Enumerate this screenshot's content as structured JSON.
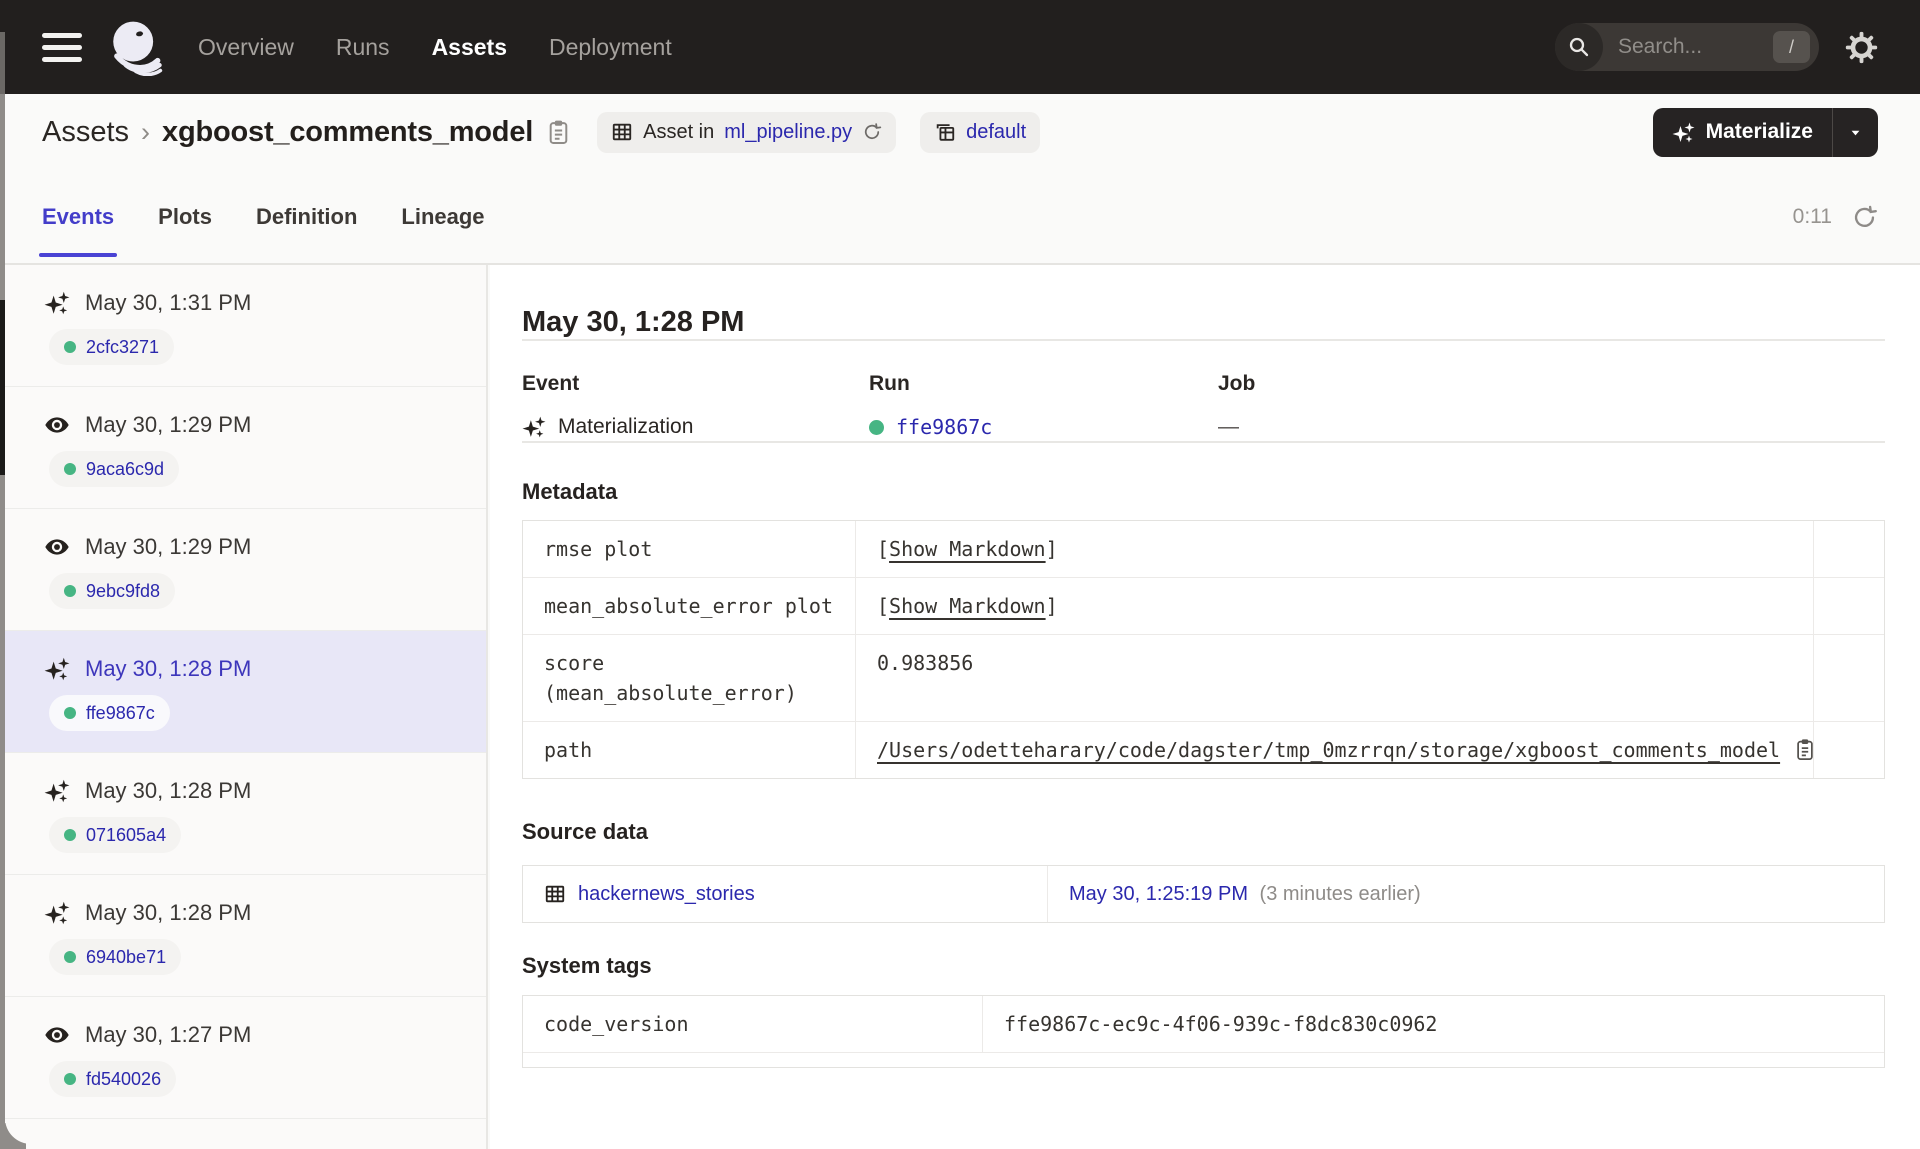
{
  "colors": {
    "nav_bg": "#221f1e",
    "accent_indigo": "#433dc9",
    "link_blue": "#2b28ad",
    "success_green": "#46b583",
    "selected_row_bg": "#e8e7f7",
    "border": "#e8e7e4",
    "page_bg": "#fafaf9",
    "dark_button_bg": "#262323"
  },
  "icons": [
    "menu-icon",
    "dagster-logo",
    "search-icon",
    "settings-gear-icon",
    "table-icon",
    "workspace-icon",
    "reload-icon",
    "copy-icon",
    "sparkle-icon",
    "eye-icon",
    "chevron-down-icon",
    "refresh-icon",
    "clipboard-icon"
  ],
  "nav": {
    "links": [
      {
        "label": "Overview",
        "active": false
      },
      {
        "label": "Runs",
        "active": false
      },
      {
        "label": "Assets",
        "active": true
      },
      {
        "label": "Deployment",
        "active": false
      }
    ],
    "search": {
      "placeholder": "Search...",
      "shortcut": "/"
    }
  },
  "header": {
    "breadcrumb": {
      "root": "Assets",
      "separator": "›",
      "current": "xgboost_comments_model"
    },
    "asset_pill": {
      "prefix": "Asset in",
      "link": "ml_pipeline.py"
    },
    "repo_pill": {
      "label": "default"
    },
    "materialize_button": {
      "label": "Materialize"
    }
  },
  "tabs": {
    "items": [
      {
        "label": "Events",
        "active": true
      },
      {
        "label": "Plots",
        "active": false
      },
      {
        "label": "Definition",
        "active": false
      },
      {
        "label": "Lineage",
        "active": false
      }
    ],
    "refresh_timer": "0:11"
  },
  "sidebar": {
    "events": [
      {
        "type": "materialization",
        "time": "May 30, 1:31 PM",
        "run_id": "2cfc3271",
        "selected": false
      },
      {
        "type": "observation",
        "time": "May 30, 1:29 PM",
        "run_id": "9aca6c9d",
        "selected": false
      },
      {
        "type": "observation",
        "time": "May 30, 1:29 PM",
        "run_id": "9ebc9fd8",
        "selected": false
      },
      {
        "type": "materialization",
        "time": "May 30, 1:28 PM",
        "run_id": "ffe9867c",
        "selected": true
      },
      {
        "type": "materialization",
        "time": "May 30, 1:28 PM",
        "run_id": "071605a4",
        "selected": false
      },
      {
        "type": "materialization",
        "time": "May 30, 1:28 PM",
        "run_id": "6940be71",
        "selected": false
      },
      {
        "type": "observation",
        "time": "May 30, 1:27 PM",
        "run_id": "fd540026",
        "selected": false
      }
    ]
  },
  "detail": {
    "title": "May 30, 1:28 PM",
    "summary": {
      "event_label": "Event",
      "event_value": "Materialization",
      "run_label": "Run",
      "run_value": "ffe9867c",
      "job_label": "Job",
      "job_value": "—"
    },
    "metadata": {
      "heading": "Metadata",
      "rows": [
        {
          "key": "rmse plot",
          "value_type": "markdown",
          "bracket_open": "[",
          "link_label": "Show Markdown",
          "bracket_close": "]"
        },
        {
          "key": "mean_absolute_error plot",
          "value_type": "markdown",
          "bracket_open": "[",
          "link_label": "Show Markdown",
          "bracket_close": "]"
        },
        {
          "key": "score\n(mean_absolute_error)",
          "value_type": "text",
          "value": "0.983856"
        },
        {
          "key": "path",
          "value_type": "path",
          "value": "/Users/odetteharary/code/dagster/tmp_0mzrrqn/storage/xgboost_comments_model"
        }
      ]
    },
    "source_data": {
      "heading": "Source data",
      "asset_link": "hackernews_stories",
      "timestamp_link": "May 30, 1:25:19 PM",
      "note": "(3 minutes earlier)"
    },
    "system_tags": {
      "heading": "System tags",
      "rows": [
        {
          "key": "code_version",
          "value": "ffe9867c-ec9c-4f06-939c-f8dc830c0962"
        }
      ]
    }
  }
}
